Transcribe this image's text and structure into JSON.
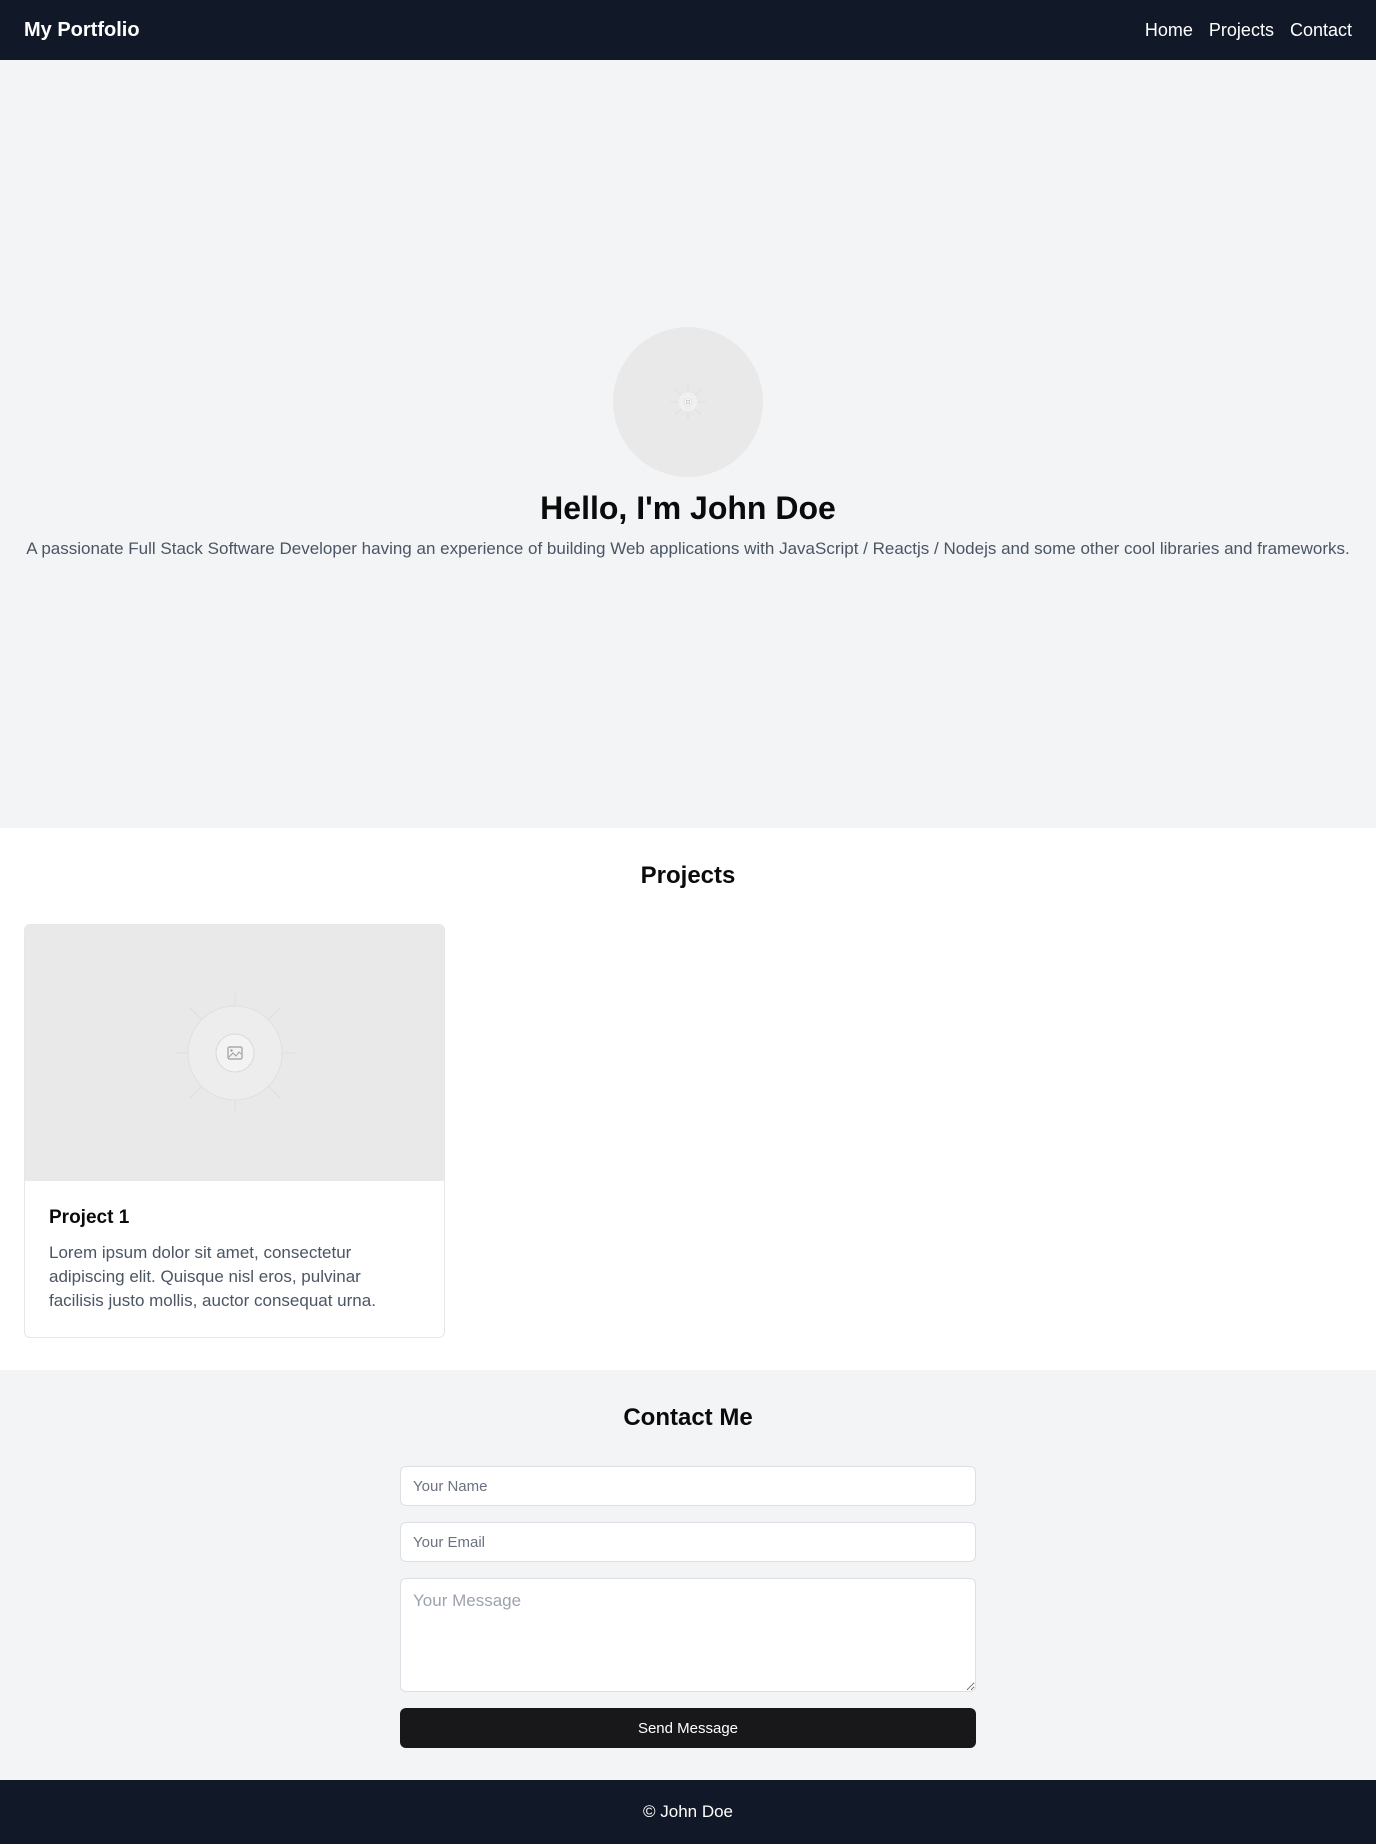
{
  "header": {
    "brand": "My Portfolio",
    "nav": [
      {
        "label": "Home"
      },
      {
        "label": "Projects"
      },
      {
        "label": "Contact"
      }
    ]
  },
  "hero": {
    "title": "Hello, I'm John Doe",
    "subtitle": "A passionate Full Stack Software Developer having an experience of building Web applications with JavaScript / Reactjs / Nodejs and some other cool libraries and frameworks.",
    "avatar_icon": "image-placeholder-icon"
  },
  "projects": {
    "title": "Projects",
    "items": [
      {
        "title": "Project 1",
        "description": "Lorem ipsum dolor sit amet, consectetur adipiscing elit. Quisque nisl eros, pulvinar facilisis justo mollis, auctor consequat urna.",
        "image_icon": "image-placeholder-icon"
      }
    ]
  },
  "contact": {
    "title": "Contact Me",
    "name_placeholder": "Your Name",
    "email_placeholder": "Your Email",
    "message_placeholder": "Your Message",
    "submit_label": "Send Message"
  },
  "footer": {
    "text": "© John Doe"
  },
  "colors": {
    "nav_bg": "#111827",
    "hero_bg": "#f3f4f6",
    "button_bg": "#18181b",
    "muted_text": "#4b5563"
  }
}
